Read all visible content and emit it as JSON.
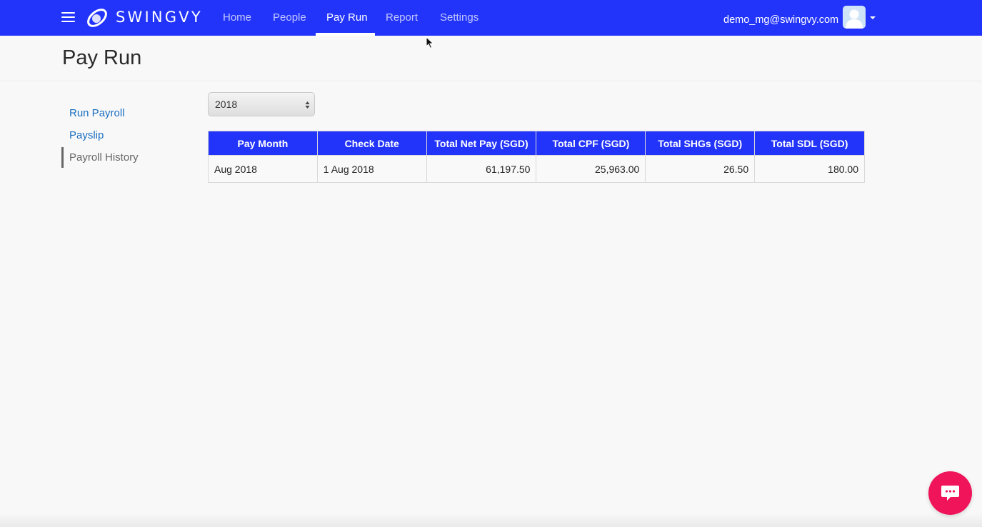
{
  "app": {
    "brand": "SWINGVY",
    "colors": {
      "primary": "#2234fa",
      "link": "#1a6fc0",
      "chat": "#f0145a"
    }
  },
  "nav": {
    "items": [
      {
        "label": "Home",
        "active": false
      },
      {
        "label": "People",
        "active": false
      },
      {
        "label": "Pay Run",
        "active": true
      },
      {
        "label": "Report",
        "active": false
      },
      {
        "label": "Settings",
        "active": false
      }
    ],
    "user_email": "demo_mg@swingvy.com",
    "icons": [
      "menu-icon",
      "swingvy-logo",
      "user-avatar",
      "caret-down-icon"
    ]
  },
  "page": {
    "title": "Pay Run"
  },
  "sidebar": {
    "items": [
      {
        "label": "Run Payroll",
        "current": false
      },
      {
        "label": "Payslip",
        "current": false
      },
      {
        "label": "Payroll History",
        "current": true
      }
    ]
  },
  "filter": {
    "year": "2018"
  },
  "table": {
    "headers": [
      "Pay Month",
      "Check Date",
      "Total Net Pay (SGD)",
      "Total CPF (SGD)",
      "Total SHGs (SGD)",
      "Total SDL (SGD)"
    ],
    "rows": [
      [
        "Aug 2018",
        "1 Aug 2018",
        "61,197.50",
        "25,963.00",
        "26.50",
        "180.00"
      ]
    ]
  },
  "chat": {
    "icon": "chat-bubble-icon"
  }
}
